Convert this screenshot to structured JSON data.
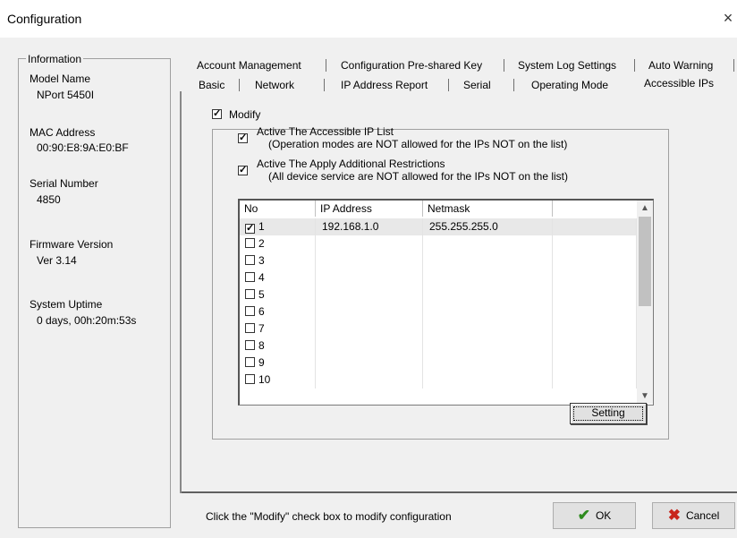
{
  "window": {
    "title": "Configuration",
    "close_glyph": "×"
  },
  "info": {
    "legend": "Information",
    "model_label": "Model Name",
    "model_value": "NPort 5450I",
    "mac_label": "MAC Address",
    "mac_value": "00:90:E8:9A:E0:BF",
    "serial_label": "Serial Number",
    "serial_value": "4850",
    "firmware_label": "Firmware Version",
    "firmware_value": "Ver 3.14",
    "uptime_label": "System Uptime",
    "uptime_value": "0 days, 00h:20m:53s"
  },
  "tabs": {
    "row1": [
      "Account Management",
      "Configuration Pre-shared Key",
      "System Log Settings",
      "Auto Warning"
    ],
    "row2": [
      "Basic",
      "Network",
      "IP Address Report",
      "Serial",
      "Operating Mode",
      "Accessible IPs"
    ],
    "active": "Accessible IPs"
  },
  "panel": {
    "modify_label": "Modify",
    "modify_checked": true,
    "active_list_label": "Active The Accessible IP List",
    "active_list_note": "(Operation modes are NOT allowed for the IPs NOT on the list)",
    "active_list_checked": true,
    "restrict_label": "Active The Apply Additional Restrictions",
    "restrict_note": "(All device service are NOT allowed for the IPs NOT on the list)",
    "restrict_checked": true,
    "columns": [
      "No",
      "IP Address",
      "Netmask",
      ""
    ],
    "rows": [
      {
        "no": "1",
        "checked": true,
        "ip": "192.168.1.0",
        "mask": "255.255.255.0"
      },
      {
        "no": "2",
        "checked": false,
        "ip": "",
        "mask": ""
      },
      {
        "no": "3",
        "checked": false,
        "ip": "",
        "mask": ""
      },
      {
        "no": "4",
        "checked": false,
        "ip": "",
        "mask": ""
      },
      {
        "no": "5",
        "checked": false,
        "ip": "",
        "mask": ""
      },
      {
        "no": "6",
        "checked": false,
        "ip": "",
        "mask": ""
      },
      {
        "no": "7",
        "checked": false,
        "ip": "",
        "mask": ""
      },
      {
        "no": "8",
        "checked": false,
        "ip": "",
        "mask": ""
      },
      {
        "no": "9",
        "checked": false,
        "ip": "",
        "mask": ""
      },
      {
        "no": "10",
        "checked": false,
        "ip": "",
        "mask": ""
      }
    ],
    "setting_button": "Setting"
  },
  "footer": {
    "status": "Click the \"Modify\" check box to modify configuration",
    "ok": "OK",
    "cancel": "Cancel"
  },
  "colors": {
    "ok_icon": "#2e8b1e",
    "cancel_icon": "#c8251b",
    "selected_row": "#e8e8e8"
  }
}
